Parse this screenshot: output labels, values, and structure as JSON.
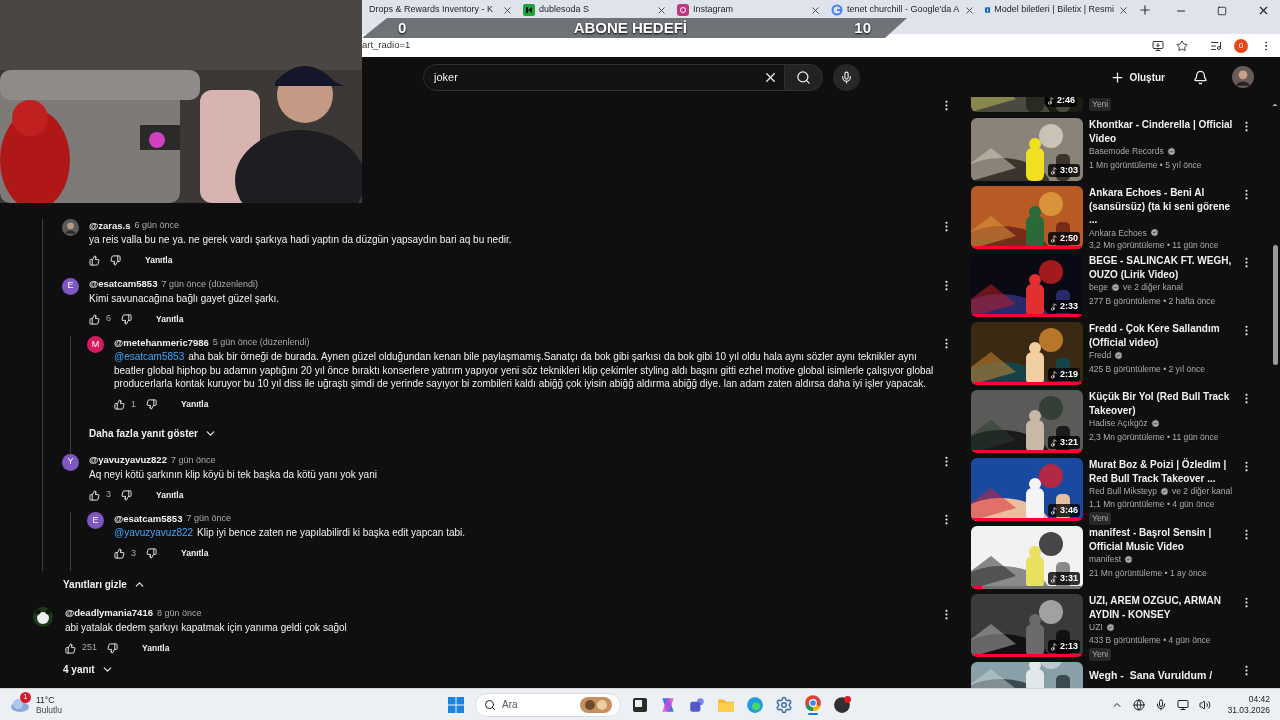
{
  "browser": {
    "tabs": [
      {
        "title": "Drops & Rewards Inventory - K",
        "selected": false
      },
      {
        "title": "dublesoda S",
        "selected": false
      },
      {
        "title": "Instagram",
        "selected": false
      },
      {
        "title": "tenet churchill - Google'da A",
        "selected": false
      },
      {
        "title": "Model biletleri | Biletix | Resmi",
        "selected": false
      }
    ],
    "url": "art_radio=1",
    "profile_badge": "0"
  },
  "overlay": {
    "current": "0",
    "goal_title": "ABONE HEDEFİ",
    "target": "10"
  },
  "header": {
    "search_value": "joker",
    "create_label": "Oluştur"
  },
  "comments": {
    "replies": [
      {
        "author": "@zaras.s",
        "time": "6 gün önce",
        "text": "ya reis valla bu ne ya. ne gerek vardı şarkıya hadi yaptın da düzgün yapsaydın bari aq bu nedir.",
        "reply_label": "Yanıtla"
      },
      {
        "author": "@esatcam5853",
        "time": "7 gün önce (düzenlendi)",
        "text": "Kimi savunacağına bağlı gayet güzel şarkı.",
        "likes": "6",
        "reply_label": "Yanıtla",
        "avatar": {
          "kind": "letter",
          "letter": "E",
          "color": "#7e57c2"
        },
        "children": [
          {
            "author": "@metehanmeric7986",
            "time": "5 gün önce (düzenlendi)",
            "mention": "@esatcam5853",
            "text": "aha bak bir örneği de burada. Aynen güzel olduğundan kenan bile paylaşmamış.Sanatçı da bok gibi şarkısı da bok gibi 10 yıl oldu hala aynı sözler aynı teknikler aynı beatler global hiphop bu adamın yaptığını 20 yıl önce bıraktı konserlere yatırım yapıyor yeni söz teknikleri klip çekimler styling aldı başını gitti ezhel motive global isimlerle çalışıyor global producerlarla kontak kuruyor bu 10 yıl diss ile uğraştı şimdi de yerinde sayıyor bi zombileri kaldı abiğğ çok iyisin abiğğ aldırma abiğğ diye. lan adam zaten aldırsa daha iyi işler yapacak.",
            "likes": "1",
            "reply_label": "Yanıtla",
            "avatar": {
              "kind": "letter",
              "letter": "M",
              "color": "#d81b60"
            }
          }
        ],
        "more_replies_label": "Daha fazla yanıt göster"
      },
      {
        "author": "@yavuzyavuz822",
        "time": "7 gün önce",
        "text": "Aq neyi kötü şarkının klip köyü bi tek başka da kötü yanı yok yani",
        "likes": "3",
        "reply_label": "Yanıtla",
        "avatar": {
          "kind": "letter",
          "letter": "Y",
          "color": "#7e57c2"
        },
        "children": [
          {
            "author": "@esatcam5853",
            "time": "7 gün önce",
            "mention": "@yavuzyavuz822",
            "text": "Klip iyi bence zaten ne yapılabilirdi ki başka edit yapcan tabi.",
            "likes": "3",
            "reply_label": "Yanıtla",
            "avatar": {
              "kind": "letter",
              "letter": "E",
              "color": "#7e57c2"
            }
          }
        ]
      }
    ],
    "hide_replies_label": "Yanıtları gizle",
    "threads": [
      {
        "author": "@deadlymania7416",
        "time": "8 gün önce",
        "text": "abi yatalak dedem şarkıyı kapatmak için yanıma geldi çok sağol",
        "likes": "251",
        "reply_label": "Yanıtla",
        "avatar": {
          "kind": "panda"
        },
        "replies_toggle": "4 yanıt"
      }
    ]
  },
  "sidebar": {
    "videos": [
      {
        "kind": "partial",
        "duration": "2:46",
        "badge": "Yeni"
      },
      {
        "kind": "full",
        "title": "Khontkar - Cinderella | Official Video",
        "channel": "Basemode Records",
        "verified": true,
        "meta": "1 Mn görüntüleme • 5 yıl önce",
        "duration": "3:03"
      },
      {
        "kind": "full",
        "title": "Ankara Echoes - Beni Al (sansürsüz) (ta ki seni görene ...",
        "channel": "Ankara Echoes",
        "verified": true,
        "meta": "3,2 Mn görüntüleme • 11 gün önce",
        "duration": "2:50",
        "level": 1
      },
      {
        "kind": "full",
        "title": "BEGE - SALINCAK FT. WEGH, OUZO (Lirik Video)",
        "channel": "bege",
        "verified": true,
        "channel_extra": "ve 2 diğer kanal",
        "meta": "277 B görüntüleme • 2 hafta önce",
        "duration": "2:33",
        "level": 1
      },
      {
        "kind": "full",
        "title": "Fredd - Çok Kere Sallandım (Official video)",
        "channel": "Fredd",
        "verified": true,
        "meta": "425 B görüntüleme • 2 yıl önce",
        "duration": "2:19",
        "level": 1
      },
      {
        "kind": "full",
        "title": "Küçük Bir Yol (Red Bull Track Takeover)",
        "channel": "Hadise Açıkgöz",
        "verified": true,
        "meta": "2,3 Mn görüntüleme • 11 gün önce",
        "duration": "3:21",
        "level": 1
      },
      {
        "kind": "full",
        "title": "Murat Boz & Poizi | Özledim | Red Bull Track Takeover ...",
        "channel": "Red Bull Miksteyp",
        "verified": true,
        "channel_extra": "ve 2 diğer kanal",
        "meta": "1,1 Mn görüntüleme • 4 gün önce",
        "badge": "Yeni",
        "duration": "3:46",
        "level": 1
      },
      {
        "kind": "full",
        "title": "manifest - Başrol Sensin | Official Music Video",
        "channel": "manifest",
        "verified": true,
        "meta": "21 Mn görüntüleme • 1 ay önce",
        "duration": "3:31",
        "level": 0.1
      },
      {
        "kind": "full",
        "title": "UZI, AREM OZGUC, ARMAN AYDIN - KONSEY",
        "channel": "UZI",
        "verified": true,
        "meta": "433 B görüntüleme • 4 gün önce",
        "badge": "Yeni",
        "duration": "2:13",
        "level": 1
      },
      {
        "kind": "cut",
        "title": "Wegh -  Sana Vuruldum /"
      }
    ]
  },
  "taskbar": {
    "weather": {
      "badge": "1",
      "temperature": "11°C",
      "condition": "Bulutlu"
    },
    "search_placeholder": "Ara",
    "time": "04:42",
    "date": "31.03.2026"
  }
}
